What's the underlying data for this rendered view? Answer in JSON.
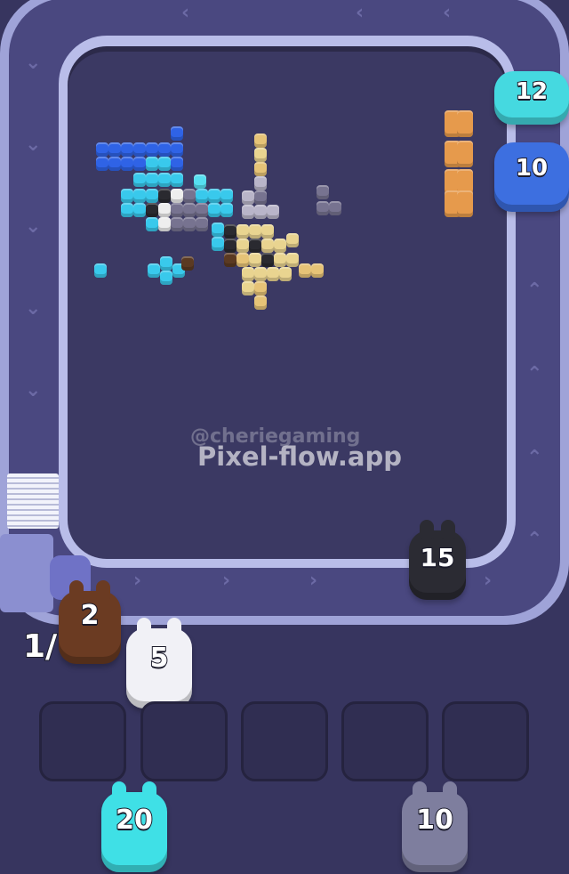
{
  "watermark": {
    "handle": "@cheriegaming",
    "site": "Pixel-flow.app"
  },
  "shooters_on_track": [
    {
      "id": "cyan-top",
      "count": "12",
      "color": "#45d9e0"
    },
    {
      "id": "blue-top",
      "count": "10",
      "color": "#3d6fe0"
    },
    {
      "id": "black",
      "count": "15",
      "color": "#2b2b33"
    },
    {
      "id": "brown",
      "count": "2",
      "color": "#6b3b22"
    }
  ],
  "queue": {
    "progress_text": "1/",
    "active": {
      "id": "white",
      "count": "5",
      "color": "#f1f1f6"
    },
    "slots_total": 5,
    "waiting": [
      {
        "id": "cyan-bottom",
        "count": "20",
        "color": "#3fe0e6"
      },
      {
        "id": "gray-bottom",
        "count": "10",
        "color": "#7e7e9e"
      }
    ]
  },
  "colors": {
    "background": "#37355f",
    "board": "#3b3963",
    "track_rail": "#9fa3d8"
  },
  "icons": [
    "chevron-up-icon",
    "chevron-down-icon",
    "chevron-right-icon"
  ]
}
